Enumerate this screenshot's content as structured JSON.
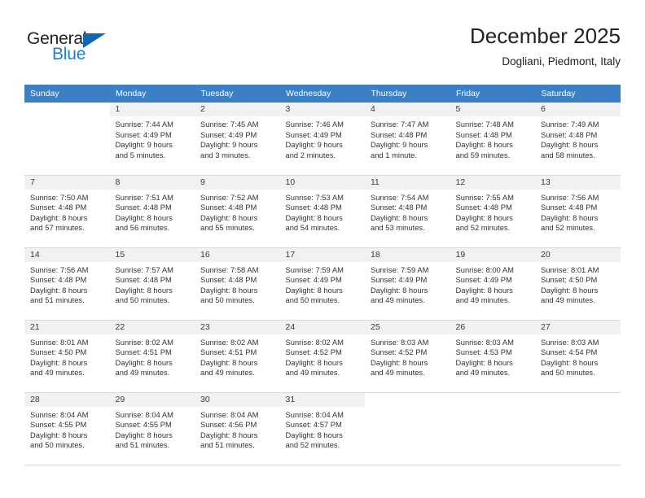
{
  "brand": {
    "name_part1": "General",
    "name_part2": "Blue",
    "triangle_color": "#1267b0",
    "accent_color": "#1b7fd4"
  },
  "header": {
    "title": "December 2025",
    "subtitle": "Dogliani, Piedmont, Italy"
  },
  "calendar": {
    "header_bg": "#3b7fc4",
    "daynum_bg": "#f1f1f1",
    "weekday_headers": [
      "Sunday",
      "Monday",
      "Tuesday",
      "Wednesday",
      "Thursday",
      "Friday",
      "Saturday"
    ],
    "weeks": [
      [
        {
          "day": "",
          "sunrise": "",
          "sunset": "",
          "daylight1": "",
          "daylight2": ""
        },
        {
          "day": "1",
          "sunrise": "Sunrise: 7:44 AM",
          "sunset": "Sunset: 4:49 PM",
          "daylight1": "Daylight: 9 hours",
          "daylight2": "and 5 minutes."
        },
        {
          "day": "2",
          "sunrise": "Sunrise: 7:45 AM",
          "sunset": "Sunset: 4:49 PM",
          "daylight1": "Daylight: 9 hours",
          "daylight2": "and 3 minutes."
        },
        {
          "day": "3",
          "sunrise": "Sunrise: 7:46 AM",
          "sunset": "Sunset: 4:49 PM",
          "daylight1": "Daylight: 9 hours",
          "daylight2": "and 2 minutes."
        },
        {
          "day": "4",
          "sunrise": "Sunrise: 7:47 AM",
          "sunset": "Sunset: 4:48 PM",
          "daylight1": "Daylight: 9 hours",
          "daylight2": "and 1 minute."
        },
        {
          "day": "5",
          "sunrise": "Sunrise: 7:48 AM",
          "sunset": "Sunset: 4:48 PM",
          "daylight1": "Daylight: 8 hours",
          "daylight2": "and 59 minutes."
        },
        {
          "day": "6",
          "sunrise": "Sunrise: 7:49 AM",
          "sunset": "Sunset: 4:48 PM",
          "daylight1": "Daylight: 8 hours",
          "daylight2": "and 58 minutes."
        }
      ],
      [
        {
          "day": "7",
          "sunrise": "Sunrise: 7:50 AM",
          "sunset": "Sunset: 4:48 PM",
          "daylight1": "Daylight: 8 hours",
          "daylight2": "and 57 minutes."
        },
        {
          "day": "8",
          "sunrise": "Sunrise: 7:51 AM",
          "sunset": "Sunset: 4:48 PM",
          "daylight1": "Daylight: 8 hours",
          "daylight2": "and 56 minutes."
        },
        {
          "day": "9",
          "sunrise": "Sunrise: 7:52 AM",
          "sunset": "Sunset: 4:48 PM",
          "daylight1": "Daylight: 8 hours",
          "daylight2": "and 55 minutes."
        },
        {
          "day": "10",
          "sunrise": "Sunrise: 7:53 AM",
          "sunset": "Sunset: 4:48 PM",
          "daylight1": "Daylight: 8 hours",
          "daylight2": "and 54 minutes."
        },
        {
          "day": "11",
          "sunrise": "Sunrise: 7:54 AM",
          "sunset": "Sunset: 4:48 PM",
          "daylight1": "Daylight: 8 hours",
          "daylight2": "and 53 minutes."
        },
        {
          "day": "12",
          "sunrise": "Sunrise: 7:55 AM",
          "sunset": "Sunset: 4:48 PM",
          "daylight1": "Daylight: 8 hours",
          "daylight2": "and 52 minutes."
        },
        {
          "day": "13",
          "sunrise": "Sunrise: 7:56 AM",
          "sunset": "Sunset: 4:48 PM",
          "daylight1": "Daylight: 8 hours",
          "daylight2": "and 52 minutes."
        }
      ],
      [
        {
          "day": "14",
          "sunrise": "Sunrise: 7:56 AM",
          "sunset": "Sunset: 4:48 PM",
          "daylight1": "Daylight: 8 hours",
          "daylight2": "and 51 minutes."
        },
        {
          "day": "15",
          "sunrise": "Sunrise: 7:57 AM",
          "sunset": "Sunset: 4:48 PM",
          "daylight1": "Daylight: 8 hours",
          "daylight2": "and 50 minutes."
        },
        {
          "day": "16",
          "sunrise": "Sunrise: 7:58 AM",
          "sunset": "Sunset: 4:48 PM",
          "daylight1": "Daylight: 8 hours",
          "daylight2": "and 50 minutes."
        },
        {
          "day": "17",
          "sunrise": "Sunrise: 7:59 AM",
          "sunset": "Sunset: 4:49 PM",
          "daylight1": "Daylight: 8 hours",
          "daylight2": "and 50 minutes."
        },
        {
          "day": "18",
          "sunrise": "Sunrise: 7:59 AM",
          "sunset": "Sunset: 4:49 PM",
          "daylight1": "Daylight: 8 hours",
          "daylight2": "and 49 minutes."
        },
        {
          "day": "19",
          "sunrise": "Sunrise: 8:00 AM",
          "sunset": "Sunset: 4:49 PM",
          "daylight1": "Daylight: 8 hours",
          "daylight2": "and 49 minutes."
        },
        {
          "day": "20",
          "sunrise": "Sunrise: 8:01 AM",
          "sunset": "Sunset: 4:50 PM",
          "daylight1": "Daylight: 8 hours",
          "daylight2": "and 49 minutes."
        }
      ],
      [
        {
          "day": "21",
          "sunrise": "Sunrise: 8:01 AM",
          "sunset": "Sunset: 4:50 PM",
          "daylight1": "Daylight: 8 hours",
          "daylight2": "and 49 minutes."
        },
        {
          "day": "22",
          "sunrise": "Sunrise: 8:02 AM",
          "sunset": "Sunset: 4:51 PM",
          "daylight1": "Daylight: 8 hours",
          "daylight2": "and 49 minutes."
        },
        {
          "day": "23",
          "sunrise": "Sunrise: 8:02 AM",
          "sunset": "Sunset: 4:51 PM",
          "daylight1": "Daylight: 8 hours",
          "daylight2": "and 49 minutes."
        },
        {
          "day": "24",
          "sunrise": "Sunrise: 8:02 AM",
          "sunset": "Sunset: 4:52 PM",
          "daylight1": "Daylight: 8 hours",
          "daylight2": "and 49 minutes."
        },
        {
          "day": "25",
          "sunrise": "Sunrise: 8:03 AM",
          "sunset": "Sunset: 4:52 PM",
          "daylight1": "Daylight: 8 hours",
          "daylight2": "and 49 minutes."
        },
        {
          "day": "26",
          "sunrise": "Sunrise: 8:03 AM",
          "sunset": "Sunset: 4:53 PM",
          "daylight1": "Daylight: 8 hours",
          "daylight2": "and 49 minutes."
        },
        {
          "day": "27",
          "sunrise": "Sunrise: 8:03 AM",
          "sunset": "Sunset: 4:54 PM",
          "daylight1": "Daylight: 8 hours",
          "daylight2": "and 50 minutes."
        }
      ],
      [
        {
          "day": "28",
          "sunrise": "Sunrise: 8:04 AM",
          "sunset": "Sunset: 4:55 PM",
          "daylight1": "Daylight: 8 hours",
          "daylight2": "and 50 minutes."
        },
        {
          "day": "29",
          "sunrise": "Sunrise: 8:04 AM",
          "sunset": "Sunset: 4:55 PM",
          "daylight1": "Daylight: 8 hours",
          "daylight2": "and 51 minutes."
        },
        {
          "day": "30",
          "sunrise": "Sunrise: 8:04 AM",
          "sunset": "Sunset: 4:56 PM",
          "daylight1": "Daylight: 8 hours",
          "daylight2": "and 51 minutes."
        },
        {
          "day": "31",
          "sunrise": "Sunrise: 8:04 AM",
          "sunset": "Sunset: 4:57 PM",
          "daylight1": "Daylight: 8 hours",
          "daylight2": "and 52 minutes."
        },
        {
          "day": "",
          "sunrise": "",
          "sunset": "",
          "daylight1": "",
          "daylight2": ""
        },
        {
          "day": "",
          "sunrise": "",
          "sunset": "",
          "daylight1": "",
          "daylight2": ""
        },
        {
          "day": "",
          "sunrise": "",
          "sunset": "",
          "daylight1": "",
          "daylight2": ""
        }
      ]
    ]
  }
}
